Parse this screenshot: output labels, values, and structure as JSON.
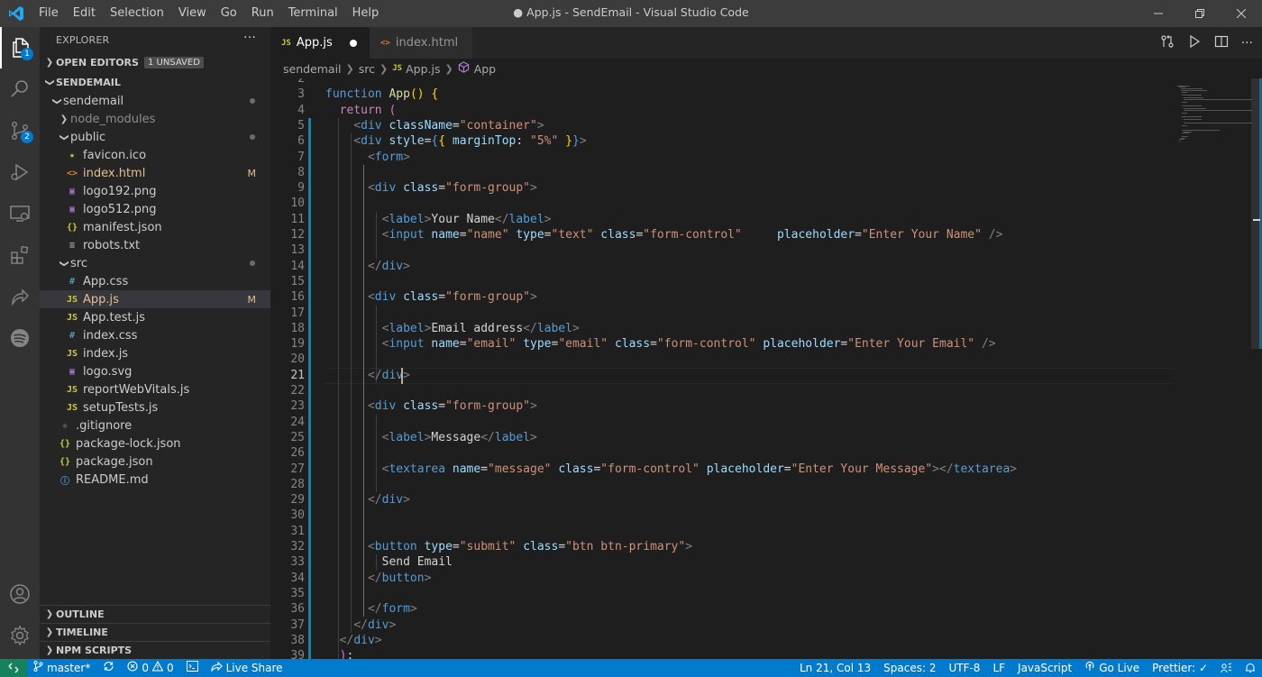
{
  "window": {
    "title": "● App.js - SendEmail - Visual Studio Code",
    "menu": [
      "File",
      "Edit",
      "Selection",
      "View",
      "Go",
      "Run",
      "Terminal",
      "Help"
    ]
  },
  "activity_bar": {
    "items": [
      {
        "name": "explorer",
        "badge": "1"
      },
      {
        "name": "search",
        "badge": ""
      },
      {
        "name": "source-control",
        "badge": "2"
      },
      {
        "name": "run-debug",
        "badge": ""
      },
      {
        "name": "remote-explorer",
        "badge": ""
      },
      {
        "name": "extensions",
        "badge": ""
      },
      {
        "name": "live-share",
        "badge": ""
      },
      {
        "name": "spotify",
        "badge": ""
      }
    ],
    "bottom": [
      "accounts",
      "manage"
    ]
  },
  "sidebar": {
    "header": "EXPLORER",
    "open_editors_label": "OPEN EDITORS",
    "unsaved_badge": "1 UNSAVED",
    "root_label": "SENDEMAIL",
    "tree": [
      {
        "label": "sendemail",
        "indent": 1,
        "type": "folder-open",
        "icon": "",
        "color": "#cccccc",
        "deco": "dot"
      },
      {
        "label": "node_modules",
        "indent": 2,
        "type": "folder-closed",
        "icon": "",
        "color": "#8c8c8c",
        "deco": ""
      },
      {
        "label": "public",
        "indent": 2,
        "type": "folder-open",
        "icon": "",
        "color": "#cccccc",
        "deco": "dot"
      },
      {
        "label": "favicon.ico",
        "indent": 3,
        "type": "file",
        "icon": "★",
        "iconColor": "#cbcb41",
        "color": "#cccccc",
        "deco": ""
      },
      {
        "label": "index.html",
        "indent": 3,
        "type": "file",
        "icon": "<>",
        "iconColor": "#e37933",
        "color": "#e2c08d",
        "deco": "M"
      },
      {
        "label": "logo192.png",
        "indent": 3,
        "type": "file",
        "icon": "▣",
        "iconColor": "#a074c4",
        "color": "#cccccc",
        "deco": ""
      },
      {
        "label": "logo512.png",
        "indent": 3,
        "type": "file",
        "icon": "▣",
        "iconColor": "#a074c4",
        "color": "#cccccc",
        "deco": ""
      },
      {
        "label": "manifest.json",
        "indent": 3,
        "type": "file",
        "icon": "{}",
        "iconColor": "#cbcb41",
        "color": "#cccccc",
        "deco": ""
      },
      {
        "label": "robots.txt",
        "indent": 3,
        "type": "file",
        "icon": "≡",
        "iconColor": "#aaaaaa",
        "color": "#cccccc",
        "deco": ""
      },
      {
        "label": "src",
        "indent": 2,
        "type": "folder-open",
        "icon": "",
        "color": "#cccccc",
        "deco": "dot"
      },
      {
        "label": "App.css",
        "indent": 3,
        "type": "file",
        "icon": "#",
        "iconColor": "#519aba",
        "color": "#cccccc",
        "deco": ""
      },
      {
        "label": "App.js",
        "indent": 3,
        "type": "file",
        "icon": "JS",
        "iconColor": "#cbcb41",
        "color": "#e2c08d",
        "deco": "M",
        "selected": true
      },
      {
        "label": "App.test.js",
        "indent": 3,
        "type": "file",
        "icon": "JS",
        "iconColor": "#cbcb41",
        "color": "#cccccc",
        "deco": ""
      },
      {
        "label": "index.css",
        "indent": 3,
        "type": "file",
        "icon": "#",
        "iconColor": "#519aba",
        "color": "#cccccc",
        "deco": ""
      },
      {
        "label": "index.js",
        "indent": 3,
        "type": "file",
        "icon": "JS",
        "iconColor": "#cbcb41",
        "color": "#cccccc",
        "deco": ""
      },
      {
        "label": "logo.svg",
        "indent": 3,
        "type": "file",
        "icon": "▣",
        "iconColor": "#a074c4",
        "color": "#cccccc",
        "deco": ""
      },
      {
        "label": "reportWebVitals.js",
        "indent": 3,
        "type": "file",
        "icon": "JS",
        "iconColor": "#cbcb41",
        "color": "#cccccc",
        "deco": ""
      },
      {
        "label": "setupTests.js",
        "indent": 3,
        "type": "file",
        "icon": "JS",
        "iconColor": "#cbcb41",
        "color": "#cccccc",
        "deco": ""
      },
      {
        "label": ".gitignore",
        "indent": 2,
        "type": "file",
        "icon": "◆",
        "iconColor": "#41535b",
        "color": "#cccccc",
        "deco": ""
      },
      {
        "label": "package-lock.json",
        "indent": 1,
        "type": "file",
        "icon": "{}",
        "iconColor": "#cbcb41",
        "color": "#cccccc",
        "deco": ""
      },
      {
        "label": "package.json",
        "indent": 1,
        "type": "file",
        "icon": "{}",
        "iconColor": "#cbcb41",
        "color": "#cccccc",
        "deco": ""
      },
      {
        "label": "README.md",
        "indent": 1,
        "type": "file",
        "icon": "ⓘ",
        "iconColor": "#519aba",
        "color": "#cccccc",
        "deco": ""
      }
    ],
    "bottom_sections": [
      "OUTLINE",
      "TIMELINE",
      "NPM SCRIPTS"
    ]
  },
  "tabs": [
    {
      "label": "App.js",
      "icon": "JS",
      "iconColor": "#cbcb41",
      "active": true,
      "dirty": true
    },
    {
      "label": "index.html",
      "icon": "<>",
      "iconColor": "#e37933",
      "active": false,
      "dirty": false
    }
  ],
  "breadcrumb": [
    "sendemail",
    "src",
    "App.js",
    "App"
  ],
  "editor": {
    "first_line": 2,
    "current_line": 21,
    "lines": [
      [],
      [
        [
          "kw",
          "function"
        ],
        [
          "t",
          " "
        ],
        [
          "fn",
          "App"
        ],
        [
          "br",
          "()"
        ],
        [
          "t",
          " "
        ],
        [
          "br",
          "{"
        ]
      ],
      [
        [
          "t",
          "  "
        ],
        [
          "ctl",
          "return"
        ],
        [
          "t",
          " "
        ],
        [
          "br2",
          "("
        ]
      ],
      [
        [
          "t",
          "    "
        ],
        [
          "p",
          "<"
        ],
        [
          "tag",
          "div"
        ],
        [
          "t",
          " "
        ],
        [
          "at",
          "className"
        ],
        [
          "t",
          "="
        ],
        [
          "s",
          "\"container\""
        ],
        [
          "p",
          ">"
        ]
      ],
      [
        [
          "t",
          "    "
        ],
        [
          "p",
          "<"
        ],
        [
          "tag",
          "div"
        ],
        [
          "t",
          " "
        ],
        [
          "at",
          "style"
        ],
        [
          "t",
          "="
        ],
        [
          "kw",
          "{"
        ],
        [
          "br",
          "{"
        ],
        [
          "t",
          " "
        ],
        [
          "at",
          "marginTop"
        ],
        [
          "t",
          ": "
        ],
        [
          "s",
          "\"5%\""
        ],
        [
          "t",
          " "
        ],
        [
          "br",
          "}"
        ],
        [
          "kw",
          "}"
        ],
        [
          "p",
          ">"
        ]
      ],
      [
        [
          "t",
          "      "
        ],
        [
          "p",
          "<"
        ],
        [
          "tag",
          "form"
        ],
        [
          "p",
          ">"
        ]
      ],
      [],
      [
        [
          "t",
          "      "
        ],
        [
          "p",
          "<"
        ],
        [
          "tag",
          "div"
        ],
        [
          "t",
          " "
        ],
        [
          "at",
          "class"
        ],
        [
          "t",
          "="
        ],
        [
          "s",
          "\"form-group\""
        ],
        [
          "p",
          ">"
        ]
      ],
      [],
      [
        [
          "t",
          "        "
        ],
        [
          "p",
          "<"
        ],
        [
          "tag",
          "label"
        ],
        [
          "p",
          ">"
        ],
        [
          "t",
          "Your Name"
        ],
        [
          "p",
          "</"
        ],
        [
          "tag",
          "label"
        ],
        [
          "p",
          ">"
        ]
      ],
      [
        [
          "t",
          "        "
        ],
        [
          "p",
          "<"
        ],
        [
          "tag",
          "input"
        ],
        [
          "t",
          " "
        ],
        [
          "at",
          "name"
        ],
        [
          "t",
          "="
        ],
        [
          "s",
          "\"name\""
        ],
        [
          "t",
          " "
        ],
        [
          "at",
          "type"
        ],
        [
          "t",
          "="
        ],
        [
          "s",
          "\"text\""
        ],
        [
          "t",
          " "
        ],
        [
          "at",
          "class"
        ],
        [
          "t",
          "="
        ],
        [
          "s",
          "\"form-control\""
        ],
        [
          "t",
          "     "
        ],
        [
          "at",
          "placeholder"
        ],
        [
          "t",
          "="
        ],
        [
          "s",
          "\"Enter Your Name\""
        ],
        [
          "t",
          " "
        ],
        [
          "p",
          "/>"
        ]
      ],
      [],
      [
        [
          "t",
          "      "
        ],
        [
          "p",
          "</"
        ],
        [
          "tag",
          "div"
        ],
        [
          "p",
          ">"
        ]
      ],
      [],
      [
        [
          "t",
          "      "
        ],
        [
          "p",
          "<"
        ],
        [
          "tag",
          "div"
        ],
        [
          "t",
          " "
        ],
        [
          "at",
          "class"
        ],
        [
          "t",
          "="
        ],
        [
          "s",
          "\"form-group\""
        ],
        [
          "p",
          ">"
        ]
      ],
      [],
      [
        [
          "t",
          "        "
        ],
        [
          "p",
          "<"
        ],
        [
          "tag",
          "label"
        ],
        [
          "p",
          ">"
        ],
        [
          "t",
          "Email address"
        ],
        [
          "p",
          "</"
        ],
        [
          "tag",
          "label"
        ],
        [
          "p",
          ">"
        ]
      ],
      [
        [
          "t",
          "        "
        ],
        [
          "p",
          "<"
        ],
        [
          "tag",
          "input"
        ],
        [
          "t",
          " "
        ],
        [
          "at",
          "name"
        ],
        [
          "t",
          "="
        ],
        [
          "s",
          "\"email\""
        ],
        [
          "t",
          " "
        ],
        [
          "at",
          "type"
        ],
        [
          "t",
          "="
        ],
        [
          "s",
          "\"email\""
        ],
        [
          "t",
          " "
        ],
        [
          "at",
          "class"
        ],
        [
          "t",
          "="
        ],
        [
          "s",
          "\"form-control\""
        ],
        [
          "t",
          " "
        ],
        [
          "at",
          "placeholder"
        ],
        [
          "t",
          "="
        ],
        [
          "s",
          "\"Enter Your Email\""
        ],
        [
          "t",
          " "
        ],
        [
          "p",
          "/>"
        ]
      ],
      [],
      [
        [
          "t",
          "      "
        ],
        [
          "p",
          "</"
        ],
        [
          "tag",
          "div"
        ],
        [
          "p",
          ">"
        ]
      ],
      [],
      [
        [
          "t",
          "      "
        ],
        [
          "p",
          "<"
        ],
        [
          "tag",
          "div"
        ],
        [
          "t",
          " "
        ],
        [
          "at",
          "class"
        ],
        [
          "t",
          "="
        ],
        [
          "s",
          "\"form-group\""
        ],
        [
          "p",
          ">"
        ]
      ],
      [],
      [
        [
          "t",
          "        "
        ],
        [
          "p",
          "<"
        ],
        [
          "tag",
          "label"
        ],
        [
          "p",
          ">"
        ],
        [
          "t",
          "Message"
        ],
        [
          "p",
          "</"
        ],
        [
          "tag",
          "label"
        ],
        [
          "p",
          ">"
        ]
      ],
      [],
      [
        [
          "t",
          "        "
        ],
        [
          "p",
          "<"
        ],
        [
          "tag",
          "textarea"
        ],
        [
          "t",
          " "
        ],
        [
          "at",
          "name"
        ],
        [
          "t",
          "="
        ],
        [
          "s",
          "\"message\""
        ],
        [
          "t",
          " "
        ],
        [
          "at",
          "class"
        ],
        [
          "t",
          "="
        ],
        [
          "s",
          "\"form-control\""
        ],
        [
          "t",
          " "
        ],
        [
          "at",
          "placeholder"
        ],
        [
          "t",
          "="
        ],
        [
          "s",
          "\"Enter Your Message\""
        ],
        [
          "p",
          "></"
        ],
        [
          "tag",
          "textarea"
        ],
        [
          "p",
          ">"
        ]
      ],
      [],
      [
        [
          "t",
          "      "
        ],
        [
          "p",
          "</"
        ],
        [
          "tag",
          "div"
        ],
        [
          "p",
          ">"
        ]
      ],
      [],
      [],
      [
        [
          "t",
          "      "
        ],
        [
          "p",
          "<"
        ],
        [
          "tag",
          "button"
        ],
        [
          "t",
          " "
        ],
        [
          "at",
          "type"
        ],
        [
          "t",
          "="
        ],
        [
          "s",
          "\"submit\""
        ],
        [
          "t",
          " "
        ],
        [
          "at",
          "class"
        ],
        [
          "t",
          "="
        ],
        [
          "s",
          "\"btn btn-primary\""
        ],
        [
          "p",
          ">"
        ]
      ],
      [
        [
          "t",
          "        Send Email"
        ]
      ],
      [
        [
          "t",
          "      "
        ],
        [
          "p",
          "</"
        ],
        [
          "tag",
          "button"
        ],
        [
          "p",
          ">"
        ]
      ],
      [],
      [
        [
          "t",
          "      "
        ],
        [
          "p",
          "</"
        ],
        [
          "tag",
          "form"
        ],
        [
          "p",
          ">"
        ]
      ],
      [
        [
          "t",
          "    "
        ],
        [
          "p",
          "</"
        ],
        [
          "tag",
          "div"
        ],
        [
          "p",
          ">"
        ]
      ],
      [
        [
          "t",
          "  "
        ],
        [
          "p",
          "</"
        ],
        [
          "tag",
          "div"
        ],
        [
          "p",
          ">"
        ]
      ],
      [
        [
          "t",
          "  "
        ],
        [
          "br2",
          ")"
        ],
        [
          "t",
          ";"
        ]
      ]
    ]
  },
  "statusbar": {
    "branch": "master*",
    "errors": "0",
    "warnings": "0",
    "live_share": "Live Share",
    "position": "Ln 21, Col 13",
    "spaces": "Spaces: 2",
    "encoding": "UTF-8",
    "eol": "LF",
    "language": "JavaScript",
    "go_live": "Go Live",
    "prettier": "Prettier: ✓"
  },
  "colors": {
    "accent": "#007acc",
    "remote": "#16825d",
    "modified": "#e2c08d"
  }
}
